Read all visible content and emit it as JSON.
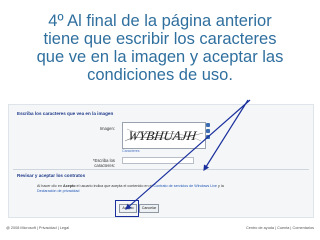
{
  "instruction": {
    "line1": "4º Al final de la página anterior",
    "line2": "tiene que escribir los caracteres",
    "line3": "que ve en la imagen y aceptar las",
    "line4": "condiciones de uso."
  },
  "form": {
    "captcha_heading": "Escriba los caracteres que vea en la imagen",
    "image_label": "Imagen:",
    "captcha_text": "WYBHUAJH",
    "captcha_link": "Caracteres",
    "chars_label": "*Escriba los caracteres:",
    "chars_value": "",
    "accept_heading": "Revisar y aceptar los contratos",
    "paragraph_start": "Al hacer clic en ",
    "paragraph_bold": "Acepto",
    "paragraph_mid": " el usuario indica que acepta el contenido en el ",
    "paragraph_link1": "Contrato de servicios de Windows Live",
    "paragraph_end": " y la",
    "paragraph_link2": "Declaración de privacidad",
    "accept_button": "Acepto",
    "cancel_button": "Cancelar"
  },
  "footer": {
    "left": "@ 2008 Microsoft | Privacidad | Legal",
    "right": "Centro de ayuda | Cuenta | Comentarios"
  },
  "colors": {
    "instruction": "#2f6f9e",
    "heading": "#1f3a8a",
    "arrow": "#1a2f9c",
    "link": "#2156b6"
  }
}
